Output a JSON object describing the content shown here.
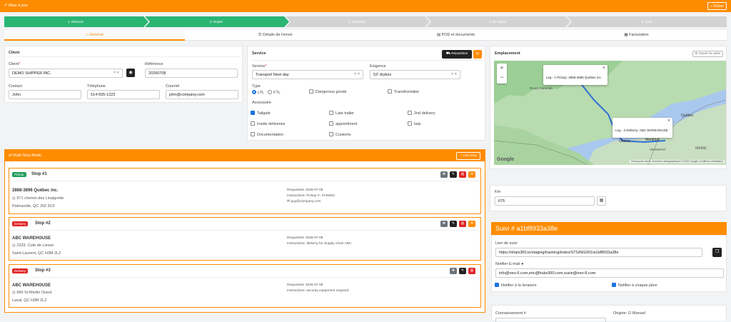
{
  "topbar": {
    "title": "✐ Mise à jour",
    "back": "« Retour"
  },
  "steps": [
    "1. Réservé",
    "2. Rejeté",
    "3. Ramassé",
    "4. En transit",
    "5. Livré"
  ],
  "tabs": [
    "⌂ Général",
    "☰ Détails de l'envoi",
    "▤ POD et documents",
    "▦ Facturation"
  ],
  "client": {
    "title": "Client",
    "client_label": "Client",
    "client_value": "DEMO SHIPPER INC.",
    "ref_label": "Référence",
    "ref_value": "20260708",
    "contact_label": "Contact",
    "contact_value": "John",
    "phone_label": "Téléphone",
    "phone_value": "514-555-1222",
    "email_label": "Courriel",
    "email_value": "john@company.com"
  },
  "service": {
    "title": "Service",
    "repartition": "Répartition",
    "service_label": "Service",
    "service_value": "Transport Next day",
    "exigence_label": "Exigence",
    "exigence_value": "53' drybox",
    "type_label": "Type",
    "ltl": "LTL",
    "ftl": "FTL",
    "dangerous": "Dangerous goods",
    "transfrontalier": "Transfrontalier",
    "accessoire_label": "Accessoire",
    "acc": [
      "Tailgate",
      "Late trailer",
      "2nd delivery",
      "Inside deliveries",
      "appointment",
      "tarp",
      "Documentation",
      "Customs"
    ]
  },
  "multistop": {
    "title": "⇄ Multi-Stop Mode",
    "add": "+ Add Stop",
    "stops": [
      {
        "badge": "Pickup",
        "title": "Stop #1",
        "name": "2868-3696 Québec inc.",
        "address": "971 chemin des Linaigrette",
        "city": "Palmarolle, QC J0Z 3C0",
        "requested": "Requested: 2026-07-08",
        "instructions": "Instructions: Pickup #: 4748303",
        "email": "guy@company.com"
      },
      {
        "badge": "Delivery",
        "title": "Stop #2",
        "name": "ABC WAREHOUSE",
        "address": "2333, Cote de Liesse",
        "city": "Saint-Laurent, QC H3M 2L2",
        "requested": "Requested: 2026-07-08",
        "instructions": "Instructions: delivery for Supply chain ABC"
      },
      {
        "badge": "Delivery",
        "title": "Stop #3",
        "name": "ABC WAREHOUSE",
        "address": "666 St-Martin Ouest",
        "city": "Laval, QC H3M 2L2",
        "requested": "Requested: 2026-07-08",
        "instructions": "Instructions: security equipment required"
      }
    ]
  },
  "map": {
    "title": "Emplacement",
    "open": "⊡ Ouvrir la carte",
    "popup1": "Leg - 1 Pickup: 2868-3696 Québec inc.",
    "popup2": "Leg - 2 Delivery: ABC WAREHOUSE",
    "labels": [
      "Québec",
      "Montréal",
      "Ottawa",
      "MAINE",
      "VERMONT",
      "Rouyn-Noranda"
    ],
    "google": "Google",
    "attribution": "Raccourcis clavier   Données cartographiques ©2026 Google   Conditions d'utilisation"
  },
  "km": {
    "label": "Km",
    "value": "675"
  },
  "suivi": {
    "title": "Suivi # a1bf8933a38e",
    "link_label": "Lien de suivi",
    "link_value": "https://shipx360.io/staging/tracking/index/STGING001/a1bf8933a38e",
    "notify_label": "Notifier E-mail",
    "notify_value": "info@neo-6.com,eric@hubx360.com,suzie@neo-6.com",
    "notify_delivery": "Notifier à la livraison",
    "notify_each": "Notifier à chaque jalon"
  },
  "connaissement": {
    "label": "Connaissement #",
    "origine": "Origine: ⊡ Manuel"
  },
  "colors": {
    "accent": "#ff8c00",
    "step_done": "#2bb573",
    "step_todo": "#d3d3d3",
    "pickup": "#1e9e5a",
    "delivery": "#e02424"
  }
}
